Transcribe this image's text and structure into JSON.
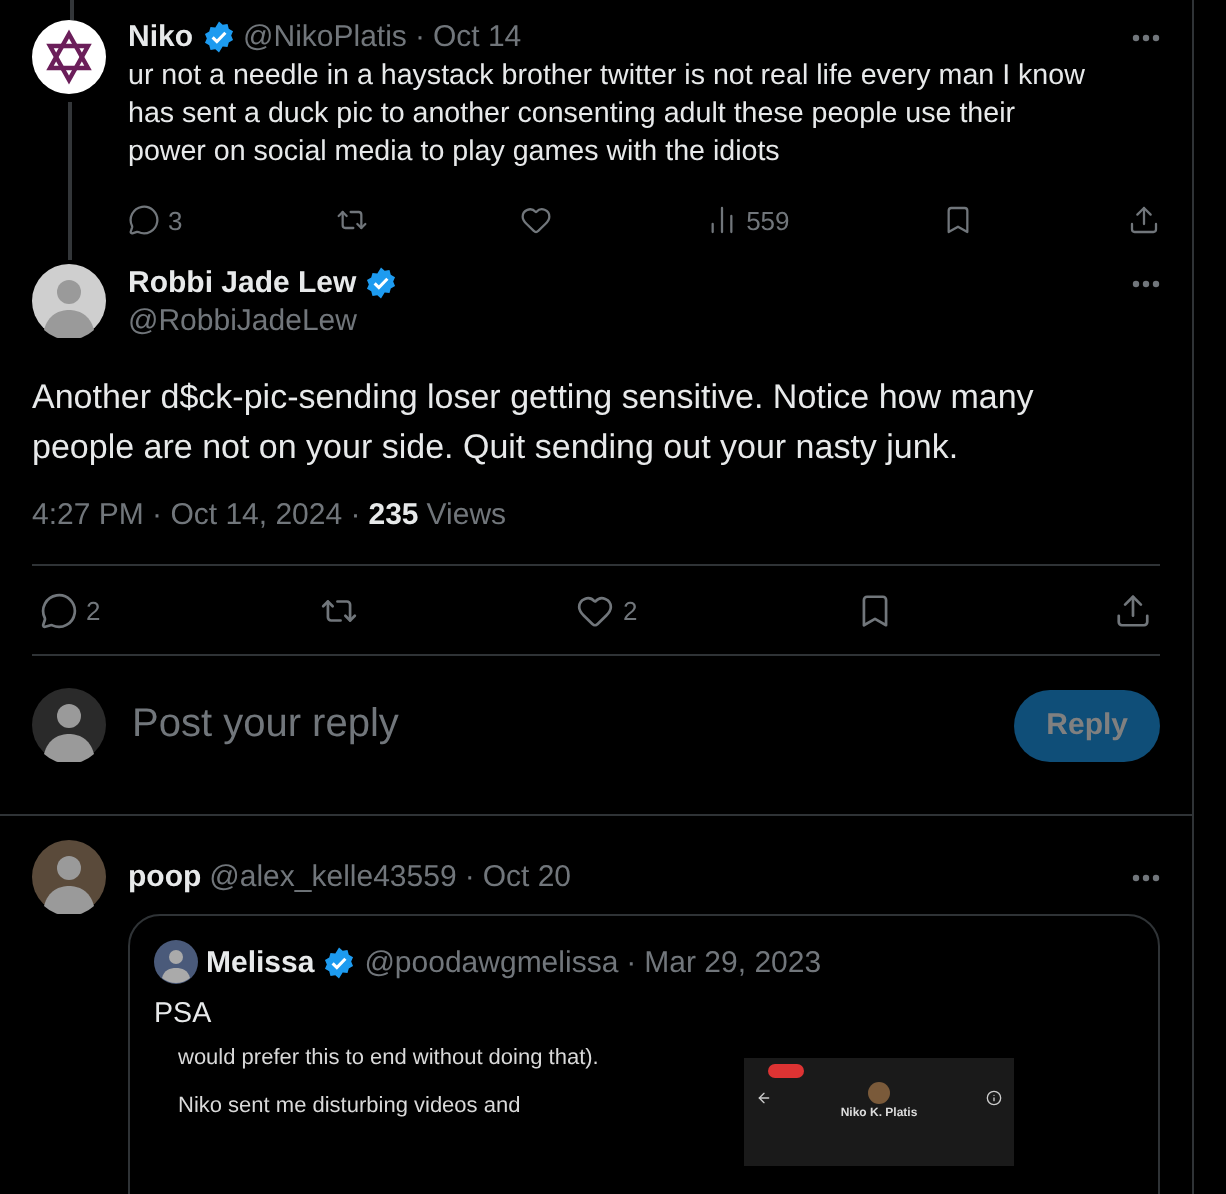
{
  "parent_tweet": {
    "name": "Niko",
    "verified": true,
    "handle": "@NikoPlatis",
    "separator": "·",
    "date": "Oct 14",
    "text": "ur not a needle in a haystack brother twitter is not real life every man I know has sent a duck pic to another consenting adult these people use their power on social media to play games with the idiots",
    "actions": [
      {
        "kind": "reply",
        "count": "3"
      },
      {
        "kind": "repost"
      },
      {
        "kind": "like"
      },
      {
        "kind": "views",
        "count": "559"
      },
      {
        "kind": "bookmark"
      },
      {
        "kind": "share"
      }
    ]
  },
  "main_tweet": {
    "name": "Robbi Jade Lew",
    "verified": true,
    "handle": "@RobbiJadeLew",
    "text": "Another d$ck-pic-sending loser getting sensitive. Notice how many people are not on your side. Quit sending out your nasty junk.",
    "time": "4:27 PM · Oct 14, 2024 · ",
    "views": "235",
    "views_label": "Views",
    "actions": [
      {
        "kind": "reply",
        "count": "2"
      },
      {
        "kind": "repost"
      },
      {
        "kind": "like",
        "count": "2"
      },
      {
        "kind": "bookmark"
      },
      {
        "kind": "share"
      }
    ]
  },
  "reply_box": {
    "placeholder": "Post your reply",
    "button": "Reply",
    "disabled": true
  },
  "reply_tweet": {
    "name": "poop",
    "handle": "@alex_kelle43559",
    "separator": "·",
    "date": "Oct 20",
    "quote": {
      "name": "Melissa",
      "verified": true,
      "handle": "@poodawgmelissa",
      "separator": "·",
      "date": "Mar 29, 2023",
      "text": "PSA",
      "media": {
        "doc_lines": [
          "would prefer this to end without doing that).",
          "Niko sent me disturbing videos and"
        ],
        "phone_name": "Niko K. Platis"
      }
    }
  }
}
